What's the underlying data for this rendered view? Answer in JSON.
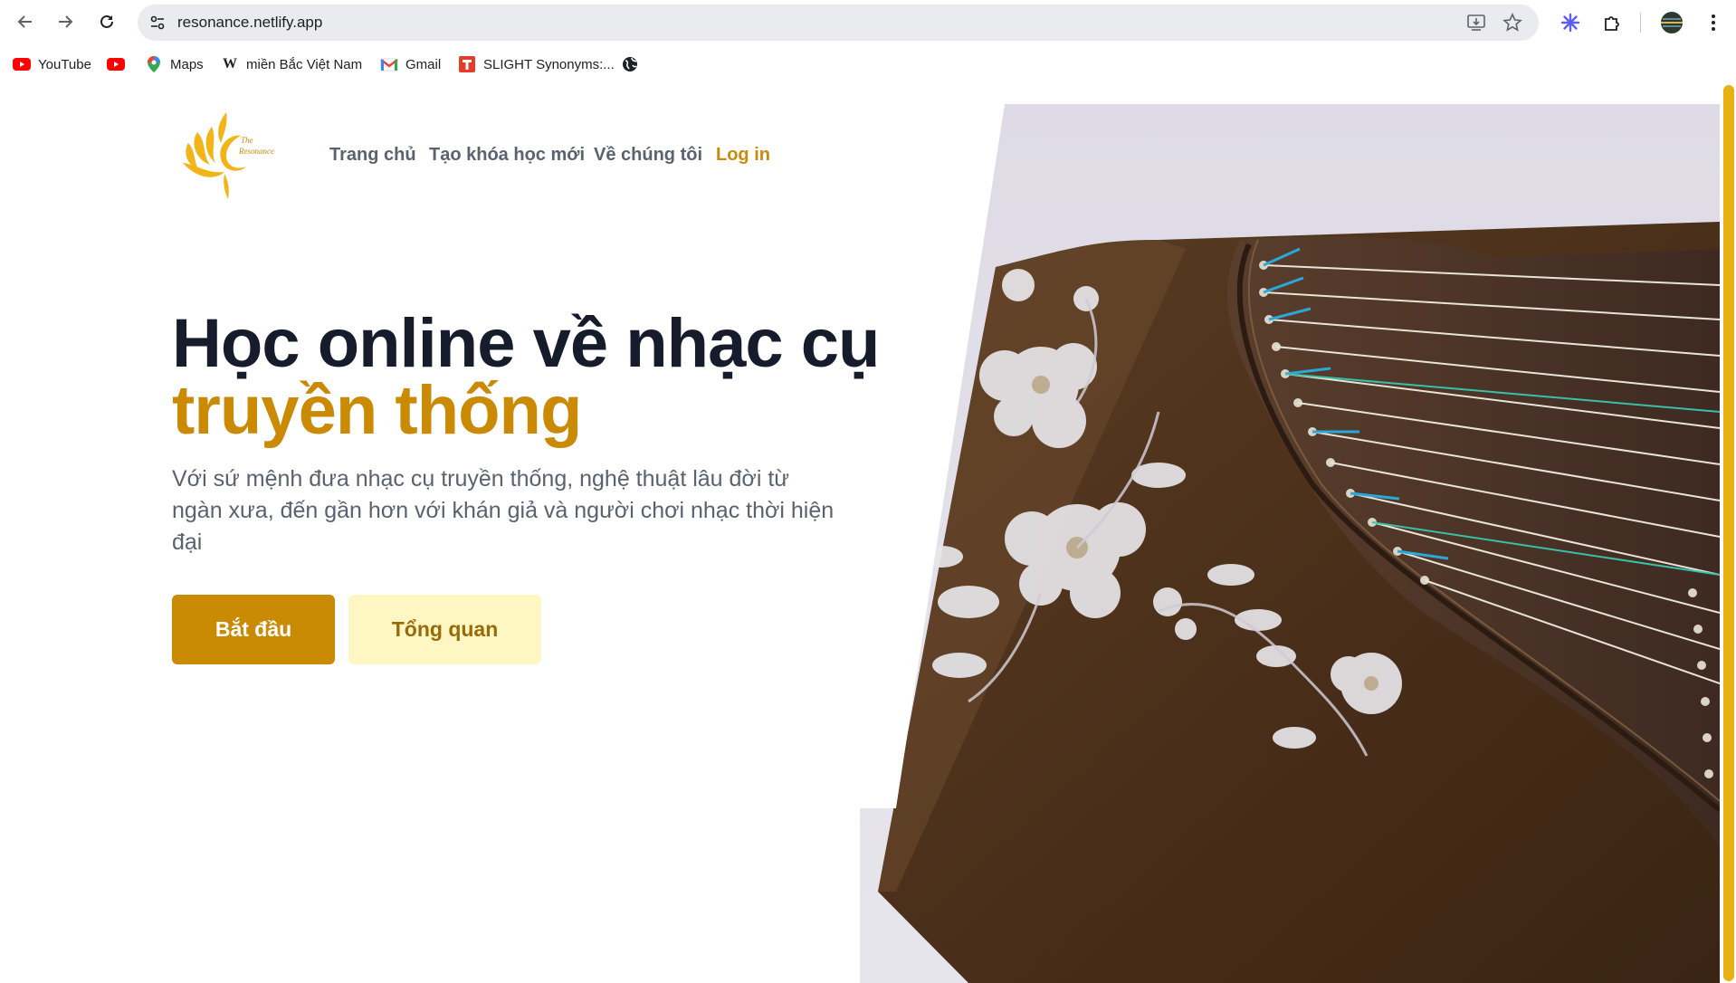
{
  "browser": {
    "url": "resonance.netlify.app",
    "nav": {
      "back_icon": "arrow-left",
      "forward_icon": "arrow-right",
      "reload_icon": "reload"
    },
    "bookmarks": [
      {
        "label": "YouTube",
        "icon": "youtube-icon"
      },
      {
        "label": "",
        "icon": "youtube-icon"
      },
      {
        "label": "Maps",
        "icon": "maps-pin-icon"
      },
      {
        "label": "miền Bắc Việt Nam",
        "icon": "wikipedia-icon"
      },
      {
        "label": "Gmail",
        "icon": "gmail-icon"
      },
      {
        "label": "SLIGHT Synonyms:...",
        "icon": "thesaurus-icon"
      },
      {
        "label": "",
        "icon": "globe-icon"
      }
    ]
  },
  "site": {
    "nav": {
      "home": "Trang chủ",
      "create_course": "Tạo khóa học mới",
      "about": "Về chúng tôi",
      "login": "Log in"
    },
    "hero": {
      "title_line1": "Học online về nhạc cụ",
      "title_line2": "truyền thống",
      "description": "Với sứ mệnh đưa nhạc cụ truyền thống, nghệ thuật lâu đời từ ngàn xưa, đến gần hơn với khán giả và người chơi nhạc thời hiện đại",
      "start_button": "Bắt đầu",
      "overview_button": "Tổng quan"
    },
    "logo_text": "The Resonance",
    "colors": {
      "accent": "#ca8a04",
      "accent_light": "#fef6c3",
      "heading": "#161c2c",
      "muted": "#5a6270"
    }
  }
}
